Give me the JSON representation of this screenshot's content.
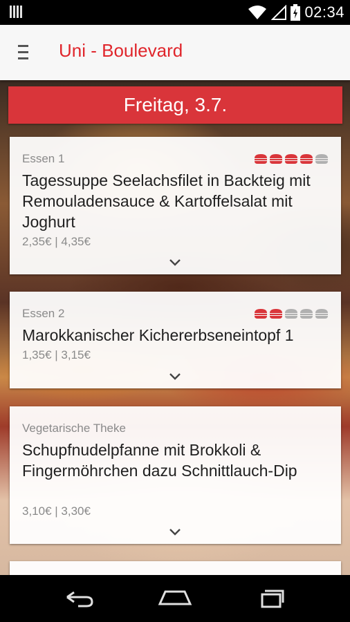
{
  "status_bar": {
    "time": "02:34",
    "icons": [
      "sim-icon",
      "wifi-icon",
      "signal-icon",
      "battery-charging-icon"
    ]
  },
  "app_bar": {
    "title": "Uni - Boulevard",
    "menu_icon": "hamburger-menu-icon"
  },
  "day": "Freitag, 3.7.",
  "colors": {
    "accent": "#d9353a",
    "title_red": "#e0262c",
    "rating_filled": "#d9353a",
    "rating_empty": "#b0b0b0"
  },
  "meals": [
    {
      "category": "Essen 1",
      "name": "Tagessuppe Seelachsfilet in Backteig mit Remouladensauce & Kartoffelsalat mit Joghurt",
      "price": "2,35€ | 4,35€",
      "rating": 4,
      "rating_max": 5
    },
    {
      "category": "Essen 2",
      "name": "Marokkanischer Kichererbseneintopf 1",
      "price": "1,35€ | 3,15€",
      "rating": 2,
      "rating_max": 5
    },
    {
      "category": "Vegetarische Theke",
      "name": "Schupfnudelpfanne mit Brokkoli & Fingermöhrchen dazu Schnittlauch-Dip",
      "price": "3,10€ | 3,30€"
    }
  ],
  "nav_bar": {
    "icons": [
      "back-icon",
      "home-icon",
      "recents-icon"
    ]
  }
}
